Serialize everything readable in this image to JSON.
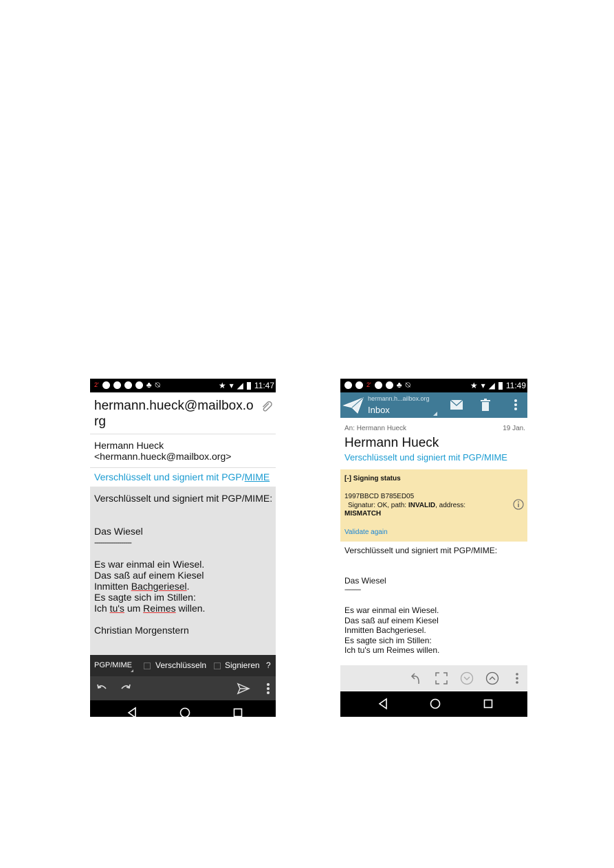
{
  "left_phone": {
    "status": {
      "time": "11:47",
      "left_icons": [
        "notification-red-icon",
        "settings-icon",
        "cloud-icon",
        "cloud-icon",
        "opera-icon",
        "app-icon",
        "muted-icon"
      ]
    },
    "to_address": "hermann.hueck@mailbox.org",
    "from_name": "Hermann Hueck",
    "from_email": "<hermann.hueck@mailbox.org>",
    "subject_prefix": "Verschlüsselt und signiert mit PGP/",
    "subject_link": "MIME",
    "body": {
      "l1": "Verschlüsselt und signiert mit PGP/MIME:",
      "l2": "Das Wiesel",
      "sep": "------------------",
      "l3": "Es war einmal ein Wiesel.",
      "l4": "Das saß auf einem Kiesel",
      "l5a": "Inmitten ",
      "l5b": "Bachgeriesel",
      "l5c": ".",
      "l6": "Es sagte sich im Stillen:",
      "l7a": "Ich ",
      "l7b": "tu's",
      "l7c": " um ",
      "l7d": "Reimes",
      "l7e": " willen.",
      "l8": "Christian Morgenstern"
    },
    "crypto_bar": {
      "method": "PGP/MIME",
      "encrypt_label": "Verschlüsseln",
      "sign_label": "Signieren",
      "help": "?"
    }
  },
  "right_phone": {
    "status": {
      "time": "11:49"
    },
    "toolbar": {
      "account": "hermann.h...ailbox.org",
      "folder": "Inbox"
    },
    "to_line": "An: Hermann Hueck",
    "date": "19 Jan.",
    "sender": "Hermann Hueck",
    "subject": "Verschlüsselt und signiert mit PGP/MIME",
    "signing": {
      "title": "[-] Signing status",
      "key_id": "1997BBCD B785ED05",
      "status_pre": "Signatur: OK, path: ",
      "status_invalid": "INVALID",
      "status_post": ", address:",
      "mismatch": "MISMATCH",
      "validate": "Validate again"
    },
    "body": {
      "l1": "Verschlüsselt und signiert mit PGP/MIME:",
      "l2": "Das Wiesel",
      "sep": "----------",
      "l3": "Es war einmal ein Wiesel.",
      "l4": "Das saß auf einem Kiesel",
      "l5": "Inmitten Bachgeriesel.",
      "l6": "Es sagte sich im Stillen:",
      "l7": "Ich tu's um Reimes willen."
    }
  },
  "colors": {
    "accent_blue": "#1a9bd1",
    "toolbar": "#3f7a96",
    "sig_bg": "#f8e6b0"
  }
}
